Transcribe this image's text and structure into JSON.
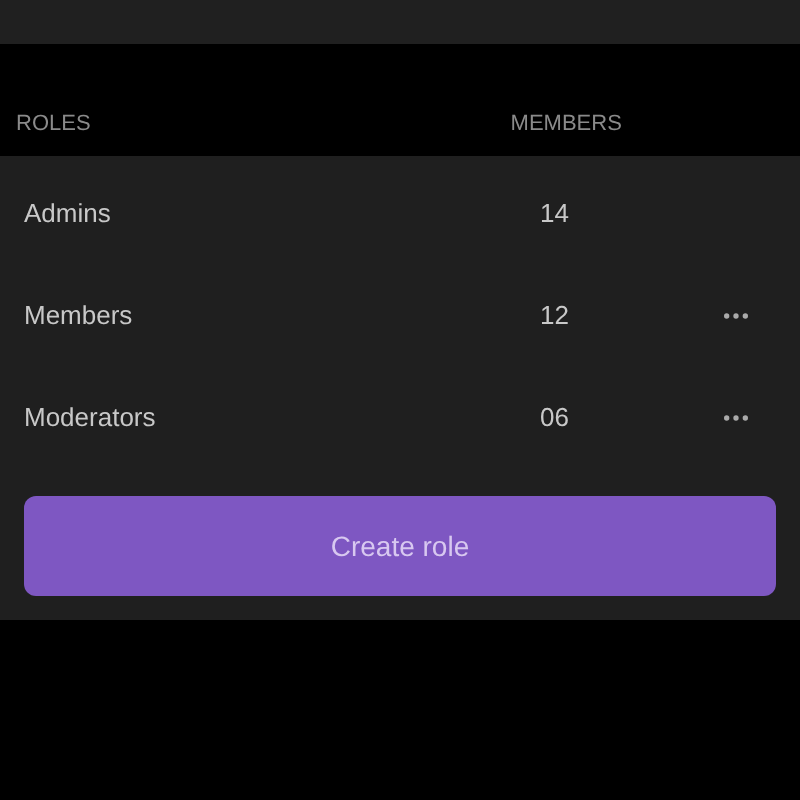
{
  "columns": [
    "ROLES",
    "MEMBERS"
  ],
  "roles": [
    {
      "name": "Admins",
      "members": "14",
      "has_menu": false
    },
    {
      "name": "Members",
      "members": "12",
      "has_menu": true
    },
    {
      "name": "Moderators",
      "members": "06",
      "has_menu": true
    }
  ],
  "create_button": "Create role"
}
